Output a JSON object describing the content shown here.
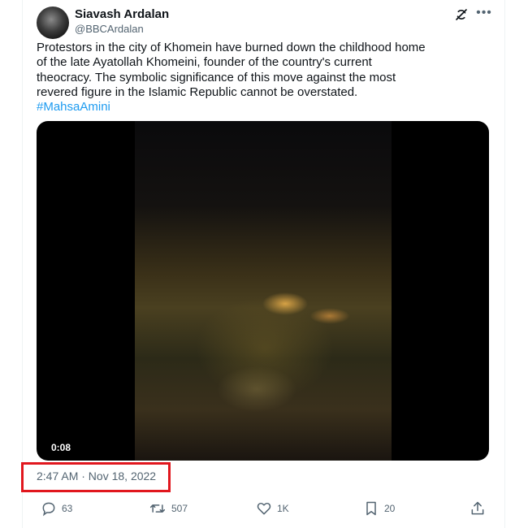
{
  "author": {
    "name": "Siavash Ardalan",
    "handle": "@BBCArdalan"
  },
  "tweet": {
    "text": "Protestors in the city of Khomein have burned down the childhood home\nof the late Ayatollah Khomeini, founder of the country's current\ntheocracy. The symbolic significance of this move against the most\nrevered figure in the Islamic Republic cannot be overstated.",
    "hashtag": "#MahsaAmini",
    "timestamp": "2:47 AM · Nov 18, 2022"
  },
  "media": {
    "duration": "0:08"
  },
  "metrics": {
    "replies": "63",
    "retweets": "507",
    "likes": "1K",
    "bookmarks": "20"
  },
  "icons": {
    "top": [
      "grok-icon",
      "more-icon"
    ],
    "actions": [
      "reply-icon",
      "retweet-icon",
      "like-icon",
      "bookmark-icon",
      "share-icon"
    ]
  },
  "colors": {
    "link": "#1d9bf0",
    "secondary_text": "#536471",
    "highlight_box": "#e1171e"
  }
}
